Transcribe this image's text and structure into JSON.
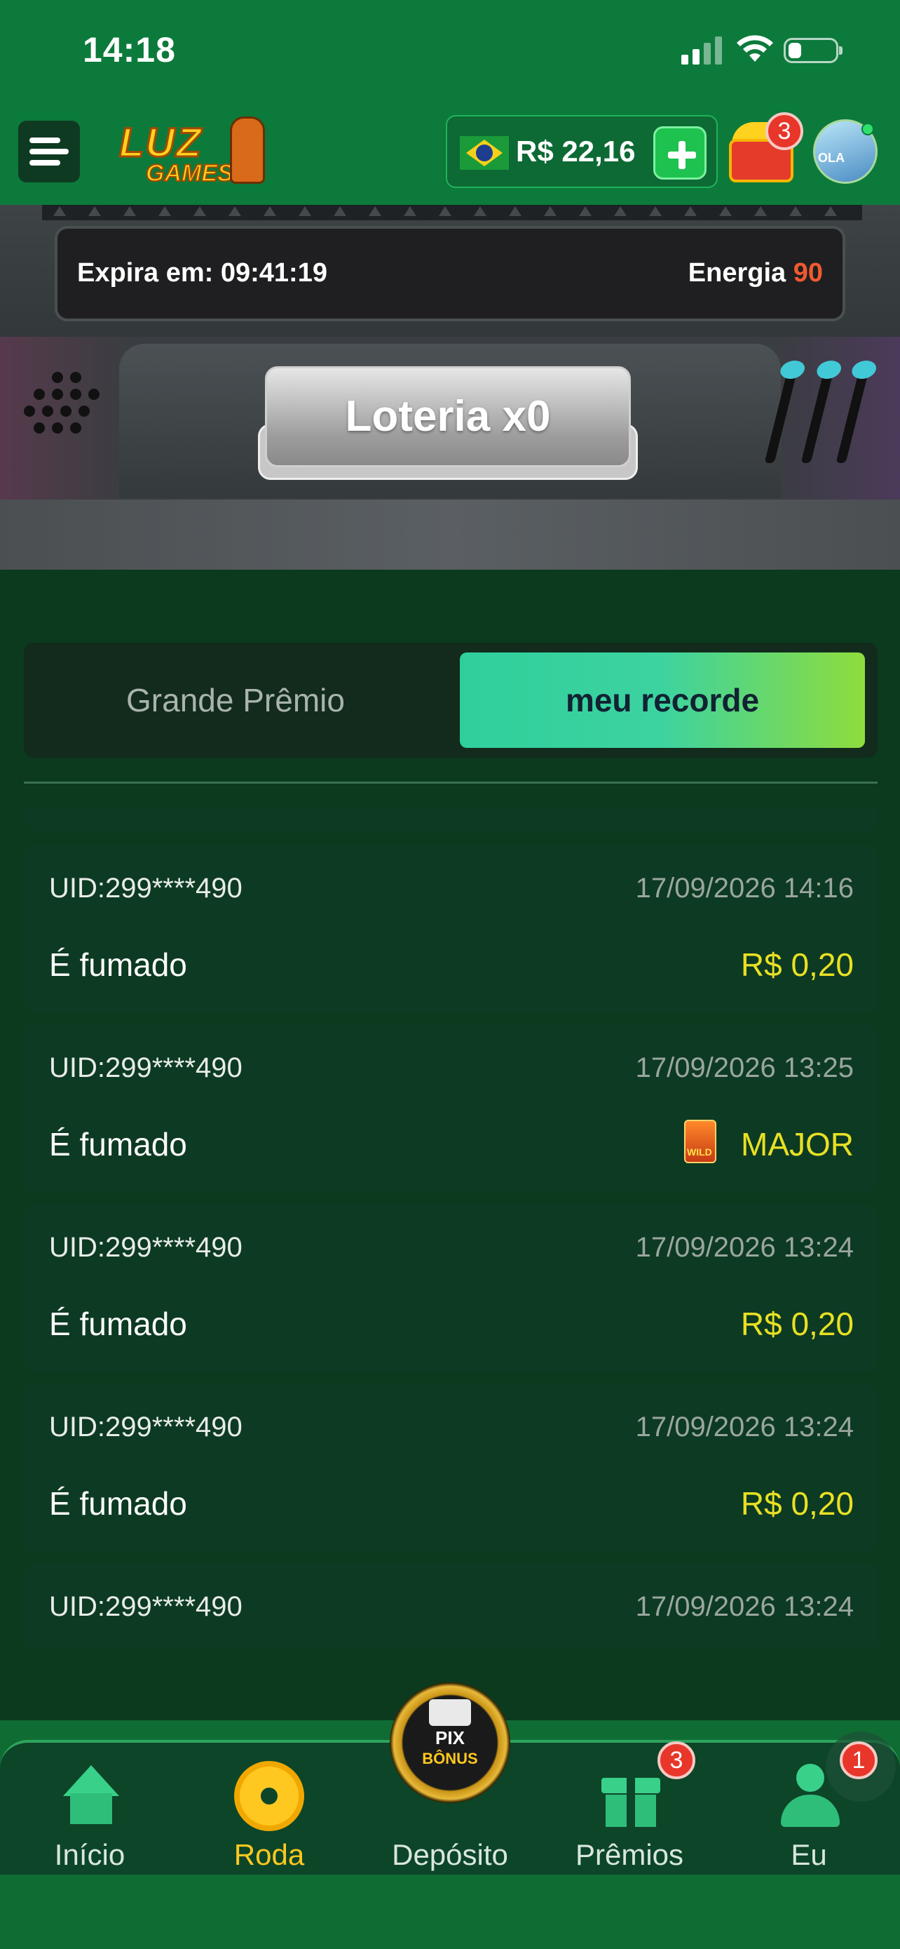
{
  "status_bar": {
    "time": "14:18"
  },
  "header": {
    "logo_line1": "LUZ",
    "logo_line2": "GAMES",
    "balance": "R$ 22,16",
    "chest_badge": "3",
    "avatar_text": "OLA"
  },
  "machine": {
    "expires_label": "Expira em: 09:41:19",
    "energy_label": "Energia",
    "energy_value": "90",
    "lottery_button": "Loteria x0"
  },
  "tabs": {
    "grand_prize": "Grande Prêmio",
    "my_record": "meu recorde",
    "active": "meu recorde"
  },
  "records": [
    {
      "uid": "UID:299****490",
      "date": "17/09/2026 14:16",
      "status": "É fumado",
      "prize": "R$ 0,20"
    },
    {
      "uid": "UID:299****490",
      "date": "17/09/2026 13:25",
      "status": "É fumado",
      "prize": "MAJOR",
      "prize_icon": "wild-icon"
    },
    {
      "uid": "UID:299****490",
      "date": "17/09/2026 13:24",
      "status": "É fumado",
      "prize": "R$ 0,20"
    },
    {
      "uid": "UID:299****490",
      "date": "17/09/2026 13:24",
      "status": "É fumado",
      "prize": "R$ 0,20"
    },
    {
      "uid": "UID:299****490",
      "date": "17/09/2026 13:24",
      "status": "",
      "prize": ""
    }
  ],
  "nav": {
    "items": [
      {
        "label": "Início",
        "icon": "home-icon"
      },
      {
        "label": "Roda",
        "icon": "wheel-icon",
        "active": true
      },
      {
        "label": "Depósito",
        "icon": "pix-bonus-icon"
      },
      {
        "label": "Prêmios",
        "icon": "gift-icon",
        "badge": "3"
      },
      {
        "label": "Eu",
        "icon": "user-icon",
        "badge": "1"
      }
    ],
    "pix_line1": "PIX",
    "pix_line2": "BÔNUS"
  },
  "colors": {
    "accent": "#0c7a3b",
    "prize": "#e8e024",
    "energy": "#f05a30",
    "active_nav": "#ffc820"
  }
}
